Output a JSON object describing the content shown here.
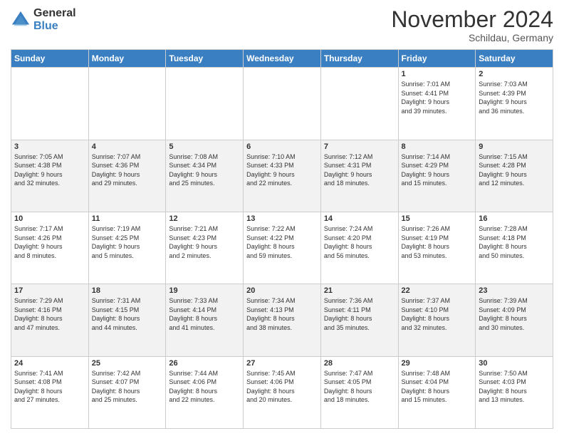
{
  "header": {
    "logo_general": "General",
    "logo_blue": "Blue",
    "month_title": "November 2024",
    "subtitle": "Schildau, Germany"
  },
  "days_of_week": [
    "Sunday",
    "Monday",
    "Tuesday",
    "Wednesday",
    "Thursday",
    "Friday",
    "Saturday"
  ],
  "weeks": [
    [
      {
        "day": "",
        "info": ""
      },
      {
        "day": "",
        "info": ""
      },
      {
        "day": "",
        "info": ""
      },
      {
        "day": "",
        "info": ""
      },
      {
        "day": "",
        "info": ""
      },
      {
        "day": "1",
        "info": "Sunrise: 7:01 AM\nSunset: 4:41 PM\nDaylight: 9 hours\nand 39 minutes."
      },
      {
        "day": "2",
        "info": "Sunrise: 7:03 AM\nSunset: 4:39 PM\nDaylight: 9 hours\nand 36 minutes."
      }
    ],
    [
      {
        "day": "3",
        "info": "Sunrise: 7:05 AM\nSunset: 4:38 PM\nDaylight: 9 hours\nand 32 minutes."
      },
      {
        "day": "4",
        "info": "Sunrise: 7:07 AM\nSunset: 4:36 PM\nDaylight: 9 hours\nand 29 minutes."
      },
      {
        "day": "5",
        "info": "Sunrise: 7:08 AM\nSunset: 4:34 PM\nDaylight: 9 hours\nand 25 minutes."
      },
      {
        "day": "6",
        "info": "Sunrise: 7:10 AM\nSunset: 4:33 PM\nDaylight: 9 hours\nand 22 minutes."
      },
      {
        "day": "7",
        "info": "Sunrise: 7:12 AM\nSunset: 4:31 PM\nDaylight: 9 hours\nand 18 minutes."
      },
      {
        "day": "8",
        "info": "Sunrise: 7:14 AM\nSunset: 4:29 PM\nDaylight: 9 hours\nand 15 minutes."
      },
      {
        "day": "9",
        "info": "Sunrise: 7:15 AM\nSunset: 4:28 PM\nDaylight: 9 hours\nand 12 minutes."
      }
    ],
    [
      {
        "day": "10",
        "info": "Sunrise: 7:17 AM\nSunset: 4:26 PM\nDaylight: 9 hours\nand 8 minutes."
      },
      {
        "day": "11",
        "info": "Sunrise: 7:19 AM\nSunset: 4:25 PM\nDaylight: 9 hours\nand 5 minutes."
      },
      {
        "day": "12",
        "info": "Sunrise: 7:21 AM\nSunset: 4:23 PM\nDaylight: 9 hours\nand 2 minutes."
      },
      {
        "day": "13",
        "info": "Sunrise: 7:22 AM\nSunset: 4:22 PM\nDaylight: 8 hours\nand 59 minutes."
      },
      {
        "day": "14",
        "info": "Sunrise: 7:24 AM\nSunset: 4:20 PM\nDaylight: 8 hours\nand 56 minutes."
      },
      {
        "day": "15",
        "info": "Sunrise: 7:26 AM\nSunset: 4:19 PM\nDaylight: 8 hours\nand 53 minutes."
      },
      {
        "day": "16",
        "info": "Sunrise: 7:28 AM\nSunset: 4:18 PM\nDaylight: 8 hours\nand 50 minutes."
      }
    ],
    [
      {
        "day": "17",
        "info": "Sunrise: 7:29 AM\nSunset: 4:16 PM\nDaylight: 8 hours\nand 47 minutes."
      },
      {
        "day": "18",
        "info": "Sunrise: 7:31 AM\nSunset: 4:15 PM\nDaylight: 8 hours\nand 44 minutes."
      },
      {
        "day": "19",
        "info": "Sunrise: 7:33 AM\nSunset: 4:14 PM\nDaylight: 8 hours\nand 41 minutes."
      },
      {
        "day": "20",
        "info": "Sunrise: 7:34 AM\nSunset: 4:13 PM\nDaylight: 8 hours\nand 38 minutes."
      },
      {
        "day": "21",
        "info": "Sunrise: 7:36 AM\nSunset: 4:11 PM\nDaylight: 8 hours\nand 35 minutes."
      },
      {
        "day": "22",
        "info": "Sunrise: 7:37 AM\nSunset: 4:10 PM\nDaylight: 8 hours\nand 32 minutes."
      },
      {
        "day": "23",
        "info": "Sunrise: 7:39 AM\nSunset: 4:09 PM\nDaylight: 8 hours\nand 30 minutes."
      }
    ],
    [
      {
        "day": "24",
        "info": "Sunrise: 7:41 AM\nSunset: 4:08 PM\nDaylight: 8 hours\nand 27 minutes."
      },
      {
        "day": "25",
        "info": "Sunrise: 7:42 AM\nSunset: 4:07 PM\nDaylight: 8 hours\nand 25 minutes."
      },
      {
        "day": "26",
        "info": "Sunrise: 7:44 AM\nSunset: 4:06 PM\nDaylight: 8 hours\nand 22 minutes."
      },
      {
        "day": "27",
        "info": "Sunrise: 7:45 AM\nSunset: 4:06 PM\nDaylight: 8 hours\nand 20 minutes."
      },
      {
        "day": "28",
        "info": "Sunrise: 7:47 AM\nSunset: 4:05 PM\nDaylight: 8 hours\nand 18 minutes."
      },
      {
        "day": "29",
        "info": "Sunrise: 7:48 AM\nSunset: 4:04 PM\nDaylight: 8 hours\nand 15 minutes."
      },
      {
        "day": "30",
        "info": "Sunrise: 7:50 AM\nSunset: 4:03 PM\nDaylight: 8 hours\nand 13 minutes."
      }
    ]
  ]
}
